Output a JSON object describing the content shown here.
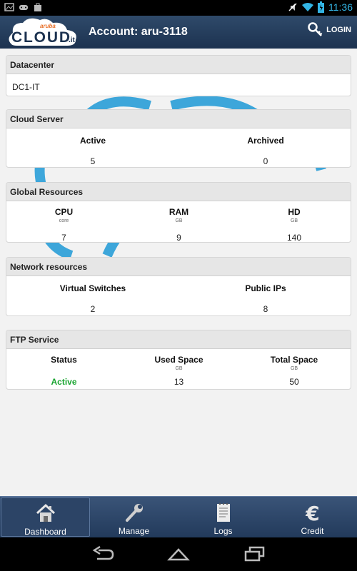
{
  "status_bar": {
    "time": "11:36"
  },
  "header": {
    "logo_brand": "aruba",
    "logo_text": "CLOUD.it",
    "account": "Account: aru-3118",
    "login_label": "LOGIN"
  },
  "datacenter": {
    "title": "Datacenter",
    "value": "DC1-IT"
  },
  "cloud_server": {
    "title": "Cloud Server",
    "cols": [
      {
        "label": "Active",
        "value": "5"
      },
      {
        "label": "Archived",
        "value": "0"
      }
    ]
  },
  "global_resources": {
    "title": "Global Resources",
    "cols": [
      {
        "label": "CPU",
        "unit": "core",
        "value": "7"
      },
      {
        "label": "RAM",
        "unit": "GB",
        "value": "9"
      },
      {
        "label": "HD",
        "unit": "GB",
        "value": "140"
      }
    ]
  },
  "network_resources": {
    "title": "Network resources",
    "cols": [
      {
        "label": "Virtual Switches",
        "value": "2"
      },
      {
        "label": "Public IPs",
        "value": "8"
      }
    ]
  },
  "ftp_service": {
    "title": "FTP Service",
    "cols": [
      {
        "label": "Status",
        "unit": "",
        "value": "Active"
      },
      {
        "label": "Used Space",
        "unit": "GB",
        "value": "13"
      },
      {
        "label": "Total Space",
        "unit": "GB",
        "value": "50"
      }
    ]
  },
  "tabs": [
    {
      "label": "Dashboard",
      "icon": "house-icon",
      "selected": true
    },
    {
      "label": "Manage",
      "icon": "wrench-icon",
      "selected": false
    },
    {
      "label": "Logs",
      "icon": "notepad-icon",
      "selected": false
    },
    {
      "label": "Credit",
      "icon": "euro-icon",
      "selected": false
    }
  ],
  "colors": {
    "accent": "#33b5e5",
    "header": "#1c3250",
    "active_status": "#1aa531"
  }
}
